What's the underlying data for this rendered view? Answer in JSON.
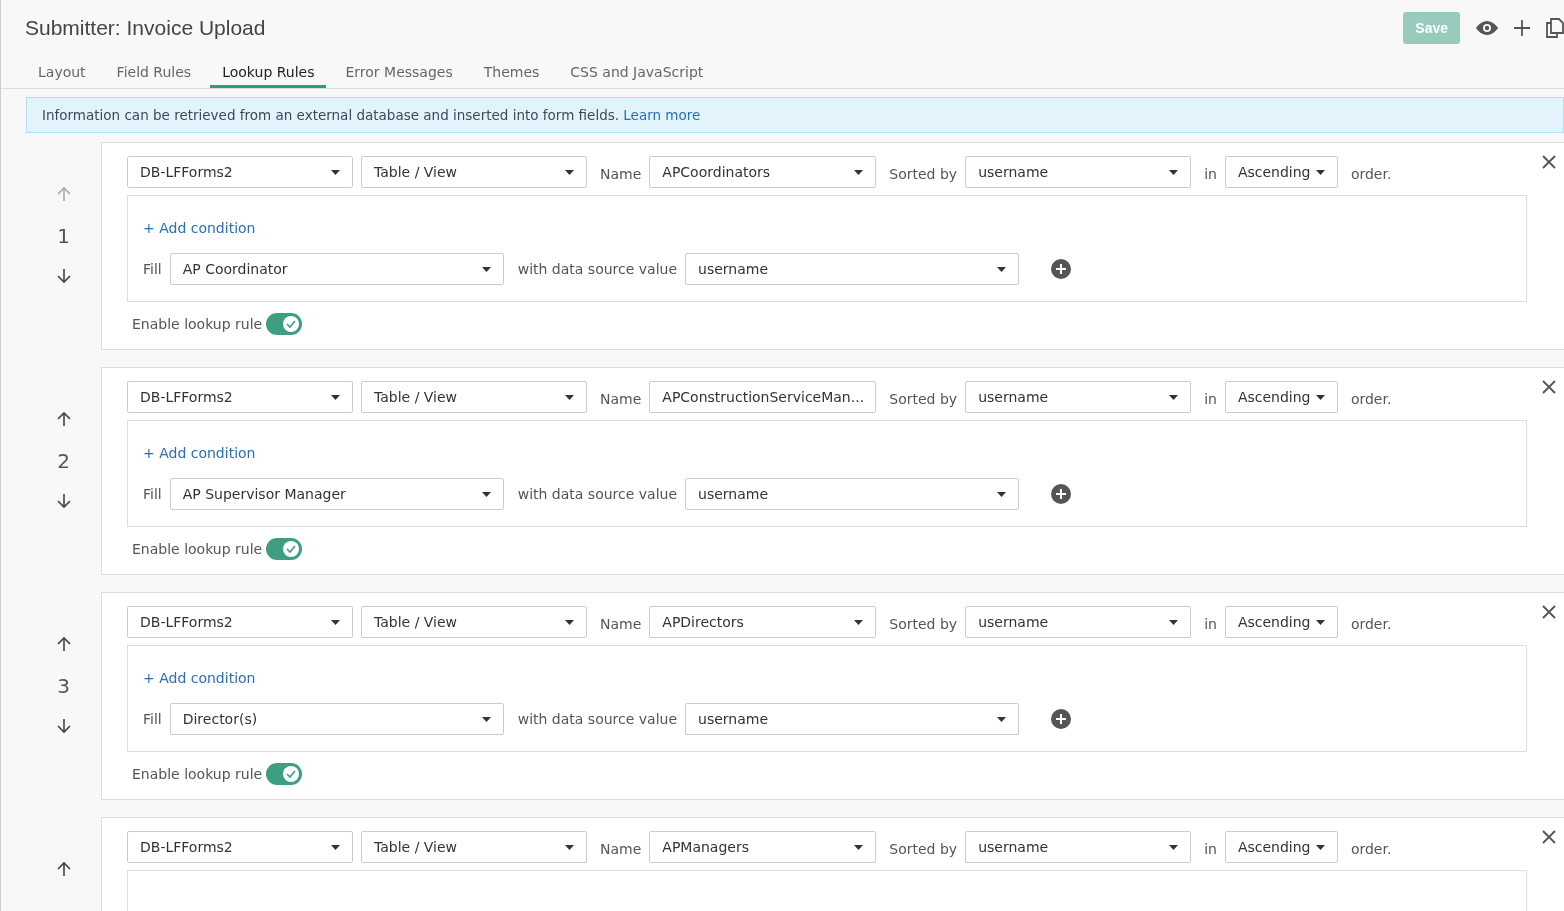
{
  "header": {
    "title": "Submitter: Invoice Upload",
    "save": "Save",
    "save_disabled": true
  },
  "tabs": [
    {
      "label": "Layout",
      "selected": false
    },
    {
      "label": "Field Rules",
      "selected": false
    },
    {
      "label": "Lookup Rules",
      "selected": true
    },
    {
      "label": "Error Messages",
      "selected": false
    },
    {
      "label": "Themes",
      "selected": false
    },
    {
      "label": "CSS and JavaScript",
      "selected": false
    }
  ],
  "info": {
    "text": "Information can be retrieved from an external database and inserted into form fields.",
    "link": "Learn more"
  },
  "rules": [
    {
      "number": "1",
      "up_disabled": true,
      "database": "DB-LFForms2",
      "source_type": "Table / View",
      "name_label": "Name",
      "name": "APCoordinators",
      "sorted_label": "Sorted by",
      "sort_field": "username",
      "in_label": "in",
      "order": "Ascending",
      "order_suffix": "order.",
      "add_condition": "+ Add condition",
      "fill_label": "Fill",
      "fill_field": "AP Coordinator",
      "value_label": "with data source value",
      "value_field": "username",
      "enable_label": "Enable lookup rule",
      "enabled": true
    },
    {
      "number": "2",
      "up_disabled": false,
      "database": "DB-LFForms2",
      "source_type": "Table / View",
      "name_label": "Name",
      "name": "APConstructionServiceMan...",
      "sorted_label": "Sorted by",
      "sort_field": "username",
      "in_label": "in",
      "order": "Ascending",
      "order_suffix": "order.",
      "add_condition": "+ Add condition",
      "fill_label": "Fill",
      "fill_field": "AP Supervisor Manager",
      "value_label": "with data source value",
      "value_field": "username",
      "enable_label": "Enable lookup rule",
      "enabled": true
    },
    {
      "number": "3",
      "up_disabled": false,
      "database": "DB-LFForms2",
      "source_type": "Table / View",
      "name_label": "Name",
      "name": "APDirectors",
      "sorted_label": "Sorted by",
      "sort_field": "username",
      "in_label": "in",
      "order": "Ascending",
      "order_suffix": "order.",
      "add_condition": "+ Add condition",
      "fill_label": "Fill",
      "fill_field": "Director(s)",
      "value_label": "with data source value",
      "value_field": "username",
      "enable_label": "Enable lookup rule",
      "enabled": true
    },
    {
      "up_disabled": false,
      "database": "DB-LFForms2",
      "source_type": "Table / View",
      "name_label": "Name",
      "name": "APManagers",
      "sorted_label": "Sorted by",
      "sort_field": "username",
      "in_label": "in",
      "order": "Ascending",
      "order_suffix": "order."
    }
  ]
}
